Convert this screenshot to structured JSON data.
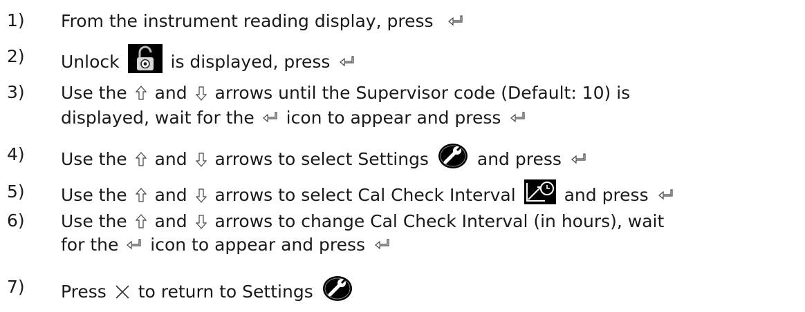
{
  "steps": [
    {
      "num": "1)",
      "a": "From the instrument reading display, press"
    },
    {
      "num": "2)",
      "a": "Unlock",
      "b": "is displayed, press"
    },
    {
      "num": "3)",
      "a": "Use the",
      "b": "and",
      "c": "arrows until the Supervisor code (Default: 10) is",
      "d": "displayed, wait for the",
      "e": "icon to appear and press"
    },
    {
      "num": "4)",
      "a": "Use the",
      "b": "and",
      "c": "arrows to select Settings",
      "d": "and press"
    },
    {
      "num": "5)",
      "a": "Use the",
      "b": "and",
      "c": "arrows to select Cal Check Interval",
      "d": "and press"
    },
    {
      "num": "6)",
      "a": "Use the",
      "b": "and",
      "c": "arrows to change Cal Check Interval (in hours), wait",
      "d": "for the",
      "e": "icon to appear and press"
    },
    {
      "num": "7)",
      "a": "Press",
      "b": "to return to Settings"
    }
  ],
  "icons": {
    "enter": "enter-arrow-icon",
    "up": "up-arrow-icon",
    "down": "down-arrow-icon",
    "unlock": "unlock-padlock-icon",
    "settings": "wrench-settings-icon",
    "cal_check": "cal-check-interval-icon",
    "close": "x-close-icon"
  }
}
